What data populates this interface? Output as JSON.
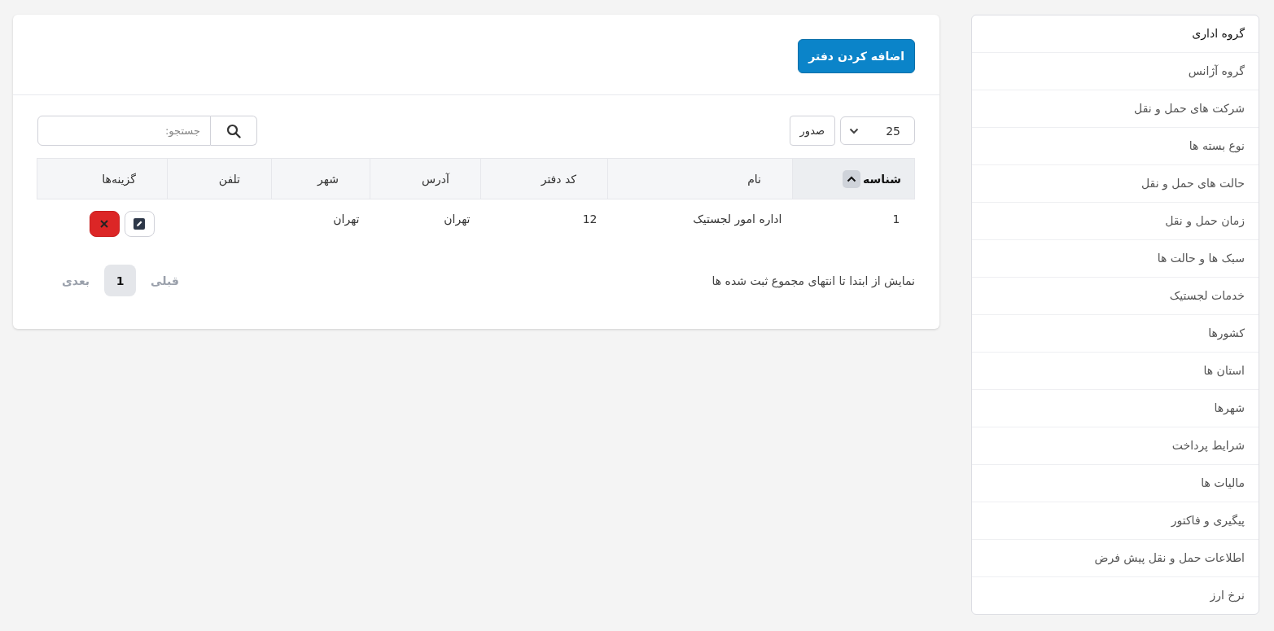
{
  "main": {
    "add_button": "اضافه کردن دفتر",
    "page_length": "25",
    "export_button": "صدور",
    "search": {
      "placeholder": "جستجو:"
    },
    "table": {
      "columns": [
        {
          "label": "شناسه",
          "sorted": true
        },
        {
          "label": "نام",
          "sorted": false
        },
        {
          "label": "کد دفتر",
          "sorted": false
        },
        {
          "label": "آدرس",
          "sorted": false
        },
        {
          "label": "شهر",
          "sorted": false
        },
        {
          "label": "تلفن",
          "sorted": false
        },
        {
          "label": "گزینه‌ها",
          "sorted": false
        }
      ],
      "rows": [
        {
          "id": "1",
          "name": "اداره امور لجستیک",
          "office_code": "12",
          "address": "تهران",
          "city": "تهران"
        }
      ]
    },
    "info": "نمایش از ابتدا تا انتهای مجموع ثبت شده ها",
    "pagination": [
      {
        "label": "قبلی",
        "kind": "prev",
        "selected": false,
        "disabled": true
      },
      {
        "label": "1",
        "kind": "page",
        "selected": true,
        "disabled": false
      },
      {
        "label": "بعدی",
        "kind": "next",
        "selected": false,
        "disabled": true
      }
    ]
  },
  "sidebar": {
    "items": [
      {
        "label": "گروه اداری",
        "selected": true
      },
      {
        "label": "گروه آژانس",
        "selected": false
      },
      {
        "label": "شرکت های حمل و نقل",
        "selected": false
      },
      {
        "label": "نوع بسته ها",
        "selected": false
      },
      {
        "label": "حالت های حمل و نقل",
        "selected": false
      },
      {
        "label": "زمان حمل و نقل",
        "selected": false
      },
      {
        "label": "سبک ها و حالت ها",
        "selected": false
      },
      {
        "label": "خدمات لجستیک",
        "selected": false
      },
      {
        "label": "کشورها",
        "selected": false
      },
      {
        "label": "استان ها",
        "selected": false
      },
      {
        "label": "شهرها",
        "selected": false
      },
      {
        "label": "شرایط پرداخت",
        "selected": false
      },
      {
        "label": "مالیات ها",
        "selected": false
      },
      {
        "label": "پیگیری و فاکتور",
        "selected": false
      },
      {
        "label": "اطلاعات حمل و نقل پیش فرض",
        "selected": false
      },
      {
        "label": "نرخ ارز",
        "selected": false
      }
    ]
  }
}
